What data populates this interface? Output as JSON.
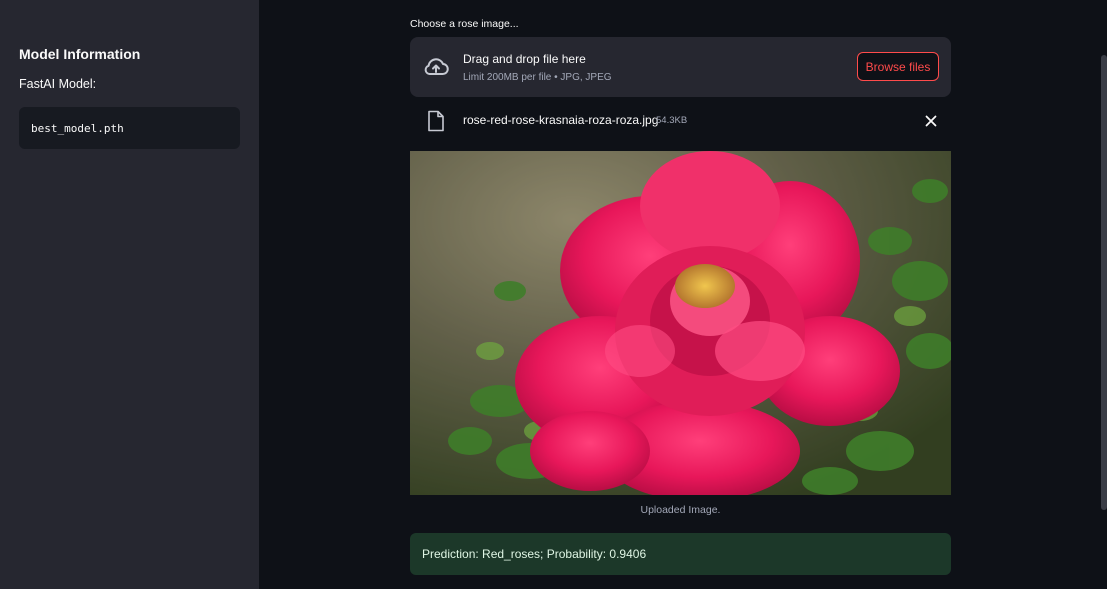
{
  "sidebar": {
    "title": "Model Information",
    "model_label": "FastAI Model:",
    "model_file": "best_model.pth"
  },
  "uploader": {
    "label": "Choose a rose image...",
    "dropzone_title": "Drag and drop file here",
    "dropzone_subtitle": "Limit 200MB per file • JPG, JPEG",
    "browse_label": "Browse files",
    "file_name": "rose-red-rose-krasnaia-roza-roza.jpg",
    "file_size": "54.3KB"
  },
  "image": {
    "caption": "Uploaded Image."
  },
  "result": {
    "text": "Prediction: Red_roses; Probability: 0.9406"
  },
  "colors": {
    "accent": "#ff4b4b",
    "sidebar_bg": "#262730",
    "main_bg": "#0e1117",
    "success_bg": "#1c3829"
  }
}
